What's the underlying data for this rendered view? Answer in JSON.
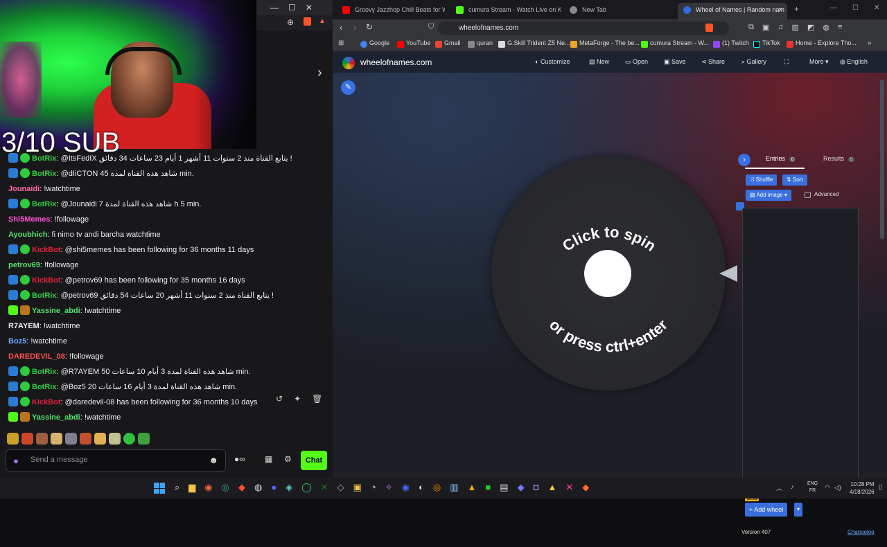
{
  "stream_overlay": {
    "sub_goal": "3/10 SUB"
  },
  "chat": {
    "messages": [
      {
        "badges": [
          "blue",
          "green"
        ],
        "user": "BotRix",
        "color": "#2ecc40",
        "text": ": @ItsFedIX يتابع القناة منذ 2 سنوات 11 أشهر 1 أيام 23 ساعات 34 دقائق !"
      },
      {
        "badges": [
          "blue",
          "green"
        ],
        "user": "BotRix",
        "color": "#2ecc40",
        "text": ": @dIiCTON شاهد هذه القناة لمدة 45 min."
      },
      {
        "badges": [],
        "user": "Jounaidi",
        "color": "#ff6b9d",
        "text": ": !watchtime"
      },
      {
        "badges": [
          "blue",
          "green"
        ],
        "user": "BotRix",
        "color": "#2ecc40",
        "text": ": @Jounaidi شاهد هذه القناة لمدة 7 h 5 min."
      },
      {
        "badges": [],
        "user": "Shi5Memes",
        "color": "#ff4fd1",
        "text": ": !followage"
      },
      {
        "badges": [],
        "user": "Ayoubhich",
        "color": "#4fe06b",
        "text": ": fi nimo tv andi barcha watchtime"
      },
      {
        "badges": [
          "blue",
          "green"
        ],
        "user": "KickBot",
        "color": "#e0203a",
        "text": ": @shi5memes has been following for 36 months 11 days"
      },
      {
        "badges": [],
        "user": "petrov69",
        "color": "#4fe06b",
        "text": ": !followage"
      },
      {
        "badges": [
          "blue",
          "green"
        ],
        "user": "KickBot",
        "color": "#e0203a",
        "text": ": @petrov69 has been following for 35 months 16 days"
      },
      {
        "badges": [
          "blue",
          "green"
        ],
        "user": "BotRix",
        "color": "#2ecc40",
        "text": ": @petrov69 يتابع القناة منذ 2 سنوات 11 أشهر 20 ساعات 54 دقائق !"
      },
      {
        "badges": [
          "kick",
          "gift"
        ],
        "user": "Yassine_abdi",
        "color": "#4fe06b",
        "text": ": !watchtime"
      },
      {
        "badges": [],
        "user": "R7AYEM",
        "color": "#efeff1",
        "text": ": !watchtime"
      },
      {
        "badges": [],
        "user": "Boz5",
        "color": "#6aa8ff",
        "text": ": !watchtime"
      },
      {
        "badges": [],
        "user": "DAREDEVIL_08",
        "color": "#ff4f4f",
        "text": ": !followage"
      },
      {
        "badges": [
          "blue",
          "green"
        ],
        "user": "BotRix",
        "color": "#2ecc40",
        "text": ": @R7AYEM شاهد هذه القناة لمدة 3 أيام 10 ساعات 50 min."
      },
      {
        "badges": [
          "blue",
          "green"
        ],
        "user": "BotRix",
        "color": "#2ecc40",
        "text": ": @Boz5 شاهد هذه القناة لمدة 3 أيام 16 ساعات 20 min."
      },
      {
        "badges": [
          "blue",
          "green"
        ],
        "user": "KickBot",
        "color": "#e0203a",
        "text": ": @daredevil-08 has been following for 36 months 10 days"
      },
      {
        "badges": [
          "kick",
          "gift"
        ],
        "user": "Yassine_abdi",
        "color": "#4fe06b",
        "text": ": !watchtime"
      }
    ],
    "input_placeholder": "Send a message",
    "send_label": "Chat"
  },
  "browser": {
    "tabs": [
      {
        "title": "Groovy Jazzhop Chill Beats for W",
        "color": "#ff0000"
      },
      {
        "title": "cumura Stream - Watch Live on Kick",
        "color": "#53fc18"
      },
      {
        "title": "New Tab",
        "color": "#888888"
      },
      {
        "title": "Wheel of Names | Random nam",
        "color": "#3369e8",
        "active": true
      }
    ],
    "url": "wheelofnames.com",
    "bookmarks": [
      "Google",
      "YouTube",
      "Gmail",
      "quran",
      "G.Skill Trident Z5 Ne...",
      "MetaForge - The be...",
      "cumura Stream - W...",
      "(1) Twitch",
      "TikTok",
      "Home - Explore Tho..."
    ]
  },
  "won": {
    "site": "wheelofnames.com",
    "menu": [
      "Customize",
      "New",
      "Open",
      "Save",
      "Share",
      "Gallery",
      "More",
      "English"
    ],
    "wheel_top": "Click to spin",
    "wheel_bottom": "or press ctrl+enter",
    "entries_tab": "Entries",
    "entries_count": "0",
    "results_tab": "Results",
    "results_count": "0",
    "shuffle": "Shuffle",
    "sort": "Sort",
    "add_image": "Add image",
    "advanced": "Advanced",
    "beta": "Beta",
    "add_wheel": "Add wheel",
    "version": "Version 407",
    "changelog": "Changelog"
  },
  "taskbar": {
    "lang1": "ENG",
    "lang2": "FR",
    "time": "10:28 PM",
    "date": "4/18/2026"
  }
}
